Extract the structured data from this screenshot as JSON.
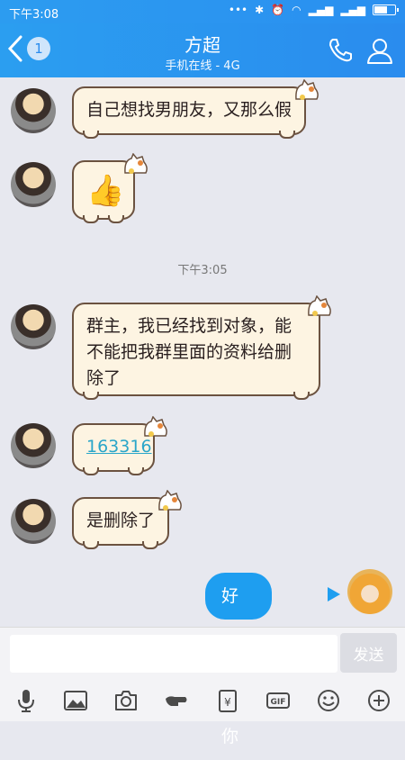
{
  "status": {
    "time": "下午3:08"
  },
  "header": {
    "back_count": "1",
    "title": "方超",
    "subtitle": "手机在线 - 4G"
  },
  "chat": {
    "messages": [
      {
        "text": "自己想找男朋友，又那么假"
      },
      {
        "text": "👍"
      },
      {
        "text": "群主，我已经找到对象，能不能把我群里面的资料给删除了"
      },
      {
        "text": "163316"
      },
      {
        "text": "是删除了"
      },
      {
        "text": "好的，恭喜你"
      }
    ],
    "time_divider": "下午3:05"
  },
  "input": {
    "send_label": "发送"
  },
  "colors": {
    "accent": "#2a8cee",
    "my_bubble": "#1e9ef0",
    "bubble_bg": "#fdf4e2"
  },
  "toolbar": {
    "icons": [
      "mic-icon",
      "image-icon",
      "camera-icon",
      "hongbao-icon",
      "transfer-icon",
      "gif-icon",
      "emoji-icon",
      "plus-icon"
    ]
  }
}
